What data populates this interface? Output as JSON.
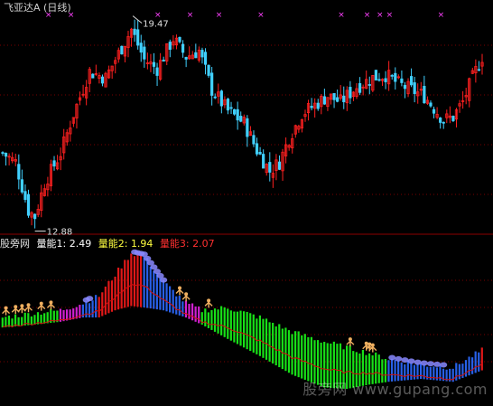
{
  "colors": {
    "background": "#000000",
    "separator": "#8b0000",
    "grid": "#7a0000",
    "up_candle": "#ff2020",
    "down_candle": "#40d0ff",
    "marker": "#ff40ff",
    "price_label": "#e0e0e0",
    "bar_red": "#e01818",
    "bar_blue": "#2860e8",
    "bar_green": "#18e018",
    "bar_magenta": "#d020d0",
    "ma_line": "#d01010",
    "bubble": "#8888ff",
    "person": "#f0b060"
  },
  "top_panel": {
    "title": "飞亚达A (日线)",
    "high_label": "19.47",
    "low_label": "12.88"
  },
  "indicator_panel": {
    "name": "股旁网",
    "v1_label": "量能1:",
    "v1_value": "2.49",
    "v2_label": "量能2:",
    "v2_value": "1.94",
    "v3_label": "量能3:",
    "v3_value": "2.07",
    "v1_color": "#ffffff",
    "v2_color": "#ffff40",
    "v3_color": "#ff3030"
  },
  "watermark": "股旁网 www.gupang.com",
  "chart_data": [
    {
      "type": "candlestick",
      "title": "飞亚达A (日线)",
      "annotations": [
        "19.47",
        "12.88"
      ],
      "price_range": [
        12.88,
        19.47
      ],
      "close_path": [
        {
          "t": 0,
          "p": 15.1
        },
        {
          "t": 4,
          "p": 14.8
        },
        {
          "t": 8,
          "p": 13.2
        },
        {
          "t": 10,
          "p": 13.0
        },
        {
          "t": 13,
          "p": 14.1
        },
        {
          "t": 18,
          "p": 15.1
        },
        {
          "t": 22,
          "p": 16.4
        },
        {
          "t": 27,
          "p": 17.8
        },
        {
          "t": 32,
          "p": 17.6
        },
        {
          "t": 37,
          "p": 18.6
        },
        {
          "t": 40,
          "p": 19.2
        },
        {
          "t": 44,
          "p": 18.2
        },
        {
          "t": 48,
          "p": 17.9
        },
        {
          "t": 53,
          "p": 18.9
        },
        {
          "t": 57,
          "p": 18.3
        },
        {
          "t": 61,
          "p": 18.5
        },
        {
          "t": 65,
          "p": 17.2
        },
        {
          "t": 70,
          "p": 16.5
        },
        {
          "t": 75,
          "p": 16.1
        },
        {
          "t": 79,
          "p": 15.2
        },
        {
          "t": 83,
          "p": 14.5
        },
        {
          "t": 86,
          "p": 14.8
        },
        {
          "t": 89,
          "p": 15.6
        },
        {
          "t": 93,
          "p": 16.4
        },
        {
          "t": 97,
          "p": 16.7
        },
        {
          "t": 101,
          "p": 17.0
        },
        {
          "t": 105,
          "p": 16.8
        },
        {
          "t": 110,
          "p": 17.3
        },
        {
          "t": 115,
          "p": 17.6
        },
        {
          "t": 119,
          "p": 17.7
        },
        {
          "t": 123,
          "p": 17.4
        },
        {
          "t": 127,
          "p": 17.2
        },
        {
          "t": 131,
          "p": 17.0
        },
        {
          "t": 134,
          "p": 16.6
        },
        {
          "t": 137,
          "p": 16.2
        },
        {
          "t": 140,
          "p": 16.3
        },
        {
          "t": 143,
          "p": 16.8
        },
        {
          "t": 146,
          "p": 17.6
        },
        {
          "t": 149,
          "p": 18.3
        }
      ],
      "markers_top": 11,
      "markers_top_symbol": "×"
    },
    {
      "type": "bar",
      "title": "股旁网",
      "series": [
        {
          "name": "量能1",
          "last": 2.49
        },
        {
          "name": "量能2",
          "last": 1.94
        },
        {
          "name": "量能3",
          "last": 2.07
        }
      ],
      "profile": [
        {
          "t": 0,
          "top": 0.55,
          "bot": 0.48,
          "c": "green"
        },
        {
          "t": 10,
          "top": 0.58,
          "bot": 0.5,
          "c": "green"
        },
        {
          "t": 18,
          "top": 0.6,
          "bot": 0.52,
          "c": "magenta"
        },
        {
          "t": 25,
          "top": 0.65,
          "bot": 0.55,
          "c": "blue"
        },
        {
          "t": 30,
          "top": 0.7,
          "bot": 0.55,
          "c": "red"
        },
        {
          "t": 35,
          "top": 0.85,
          "bot": 0.6,
          "c": "red"
        },
        {
          "t": 40,
          "top": 1.0,
          "bot": 0.63,
          "c": "red"
        },
        {
          "t": 44,
          "top": 0.98,
          "bot": 0.62,
          "c": "blue"
        },
        {
          "t": 50,
          "top": 0.8,
          "bot": 0.6,
          "c": "blue"
        },
        {
          "t": 57,
          "top": 0.65,
          "bot": 0.55,
          "c": "magenta"
        },
        {
          "t": 62,
          "top": 0.6,
          "bot": 0.5,
          "c": "green"
        },
        {
          "t": 70,
          "top": 0.62,
          "bot": 0.4,
          "c": "green"
        },
        {
          "t": 80,
          "top": 0.55,
          "bot": 0.28,
          "c": "green"
        },
        {
          "t": 90,
          "top": 0.45,
          "bot": 0.15,
          "c": "green"
        },
        {
          "t": 100,
          "top": 0.38,
          "bot": 0.06,
          "c": "green"
        },
        {
          "t": 107,
          "top": 0.34,
          "bot": 0.05,
          "c": "green"
        },
        {
          "t": 114,
          "top": 0.3,
          "bot": 0.08,
          "c": "green"
        },
        {
          "t": 120,
          "top": 0.26,
          "bot": 0.1,
          "c": "blue"
        },
        {
          "t": 130,
          "top": 0.22,
          "bot": 0.12,
          "c": "blue"
        },
        {
          "t": 140,
          "top": 0.2,
          "bot": 0.1,
          "c": "blue"
        },
        {
          "t": 149,
          "top": 0.32,
          "bot": 0.18,
          "c": "red"
        }
      ]
    }
  ]
}
